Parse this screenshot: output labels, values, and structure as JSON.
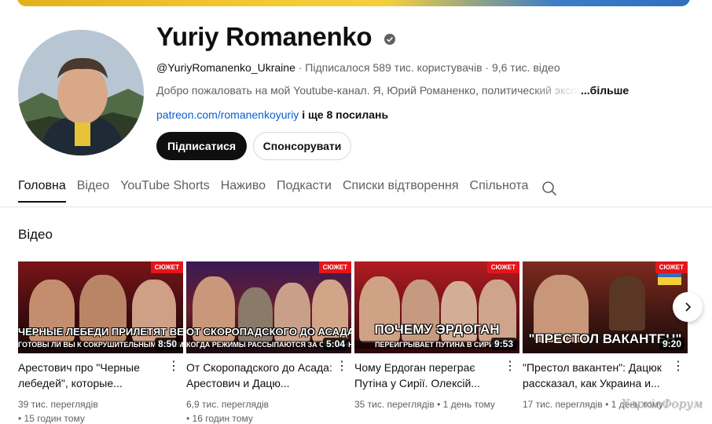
{
  "channel": {
    "name": "Yuriy Romanenko",
    "handle": "@YuriyRomanenko_Ukraine",
    "subscribers": " · Підписалося 589 тис. користувачів · 9,6 тис. відео",
    "description": "Добро пожаловать на мой Youtube-канал. Я, Юрий Романенко, политический эксперт",
    "more_label": "...більше",
    "link": "patreon.com/romanenkoyuriy",
    "more_links": " і ще 8 посилань",
    "verified_icon": "verified-check-icon"
  },
  "buttons": {
    "subscribe": "Підписатися",
    "sponsor": "Спонсорувати"
  },
  "tabs": [
    {
      "label": "Головна",
      "active": true
    },
    {
      "label": "Відео"
    },
    {
      "label": "YouTube Shorts"
    },
    {
      "label": "Наживо"
    },
    {
      "label": "Подкасти"
    },
    {
      "label": "Списки відтворення"
    },
    {
      "label": "Спільнота"
    }
  ],
  "section": {
    "title": "Відео"
  },
  "videos": [
    {
      "title": "Арестович про \"Черные лебедей\", которые...",
      "duration": "8:50",
      "views": "39 тис. переглядів",
      "age": "• 15 годин тому",
      "badge": "СЮЖЕТ",
      "thumb_caption": "ЧЕРНЫЕ ЛЕБЕДИ ПРИЛЕТЯТ ВЕСНОЙ",
      "thumb_sub": "ГОТОВЫ ЛИ ВЫ К СОКРУШИТЕЛЬНЫМ ПЕРЕМЕНАМ?"
    },
    {
      "title": "От Скоропадского до Асада: Арестович и Дацю...",
      "duration": "5:04",
      "views": "6,9 тис. переглядів",
      "age": "• 16 годин тому",
      "badge": "СЮЖЕТ",
      "thumb_caption": "ОТ СКОРОПАДСКОГО ДО АСАДА:",
      "thumb_sub": "КОГДА РЕЖИМЫ РАССЫПАЮТСЯ ЗА СЧИТАННЫЕ ДНИ"
    },
    {
      "title": "Чому Ердоган переграє Путіна у Сирії. Олексій...",
      "duration": "9:53",
      "views": "35 тис. переглядів",
      "age": " • 1 день тому",
      "badge": "СЮЖЕТ",
      "thumb_caption": "ПОЧЕМУ ЭРДОГАН",
      "thumb_sub": "ПЕРЕИГРЫВАЕТ ПУТИНА В СИРИИ"
    },
    {
      "title": "\"Престол вакантен\": Дацюк рассказал, как Украина и...",
      "duration": "9:20",
      "views": "17 тис. переглядів",
      "age": " • 1 день тому",
      "badge": "СЮЖЕТ",
      "thumb_caption": "\"ПРЕСТОЛ ВАКАНТЕН\"",
      "thumb_sub": ""
    }
  ],
  "watermark": "ХарківФорум",
  "colors": {
    "accent_red": "#e4161b",
    "subscribe_bg": "#0f0f0f",
    "link_blue": "#065fd4"
  }
}
